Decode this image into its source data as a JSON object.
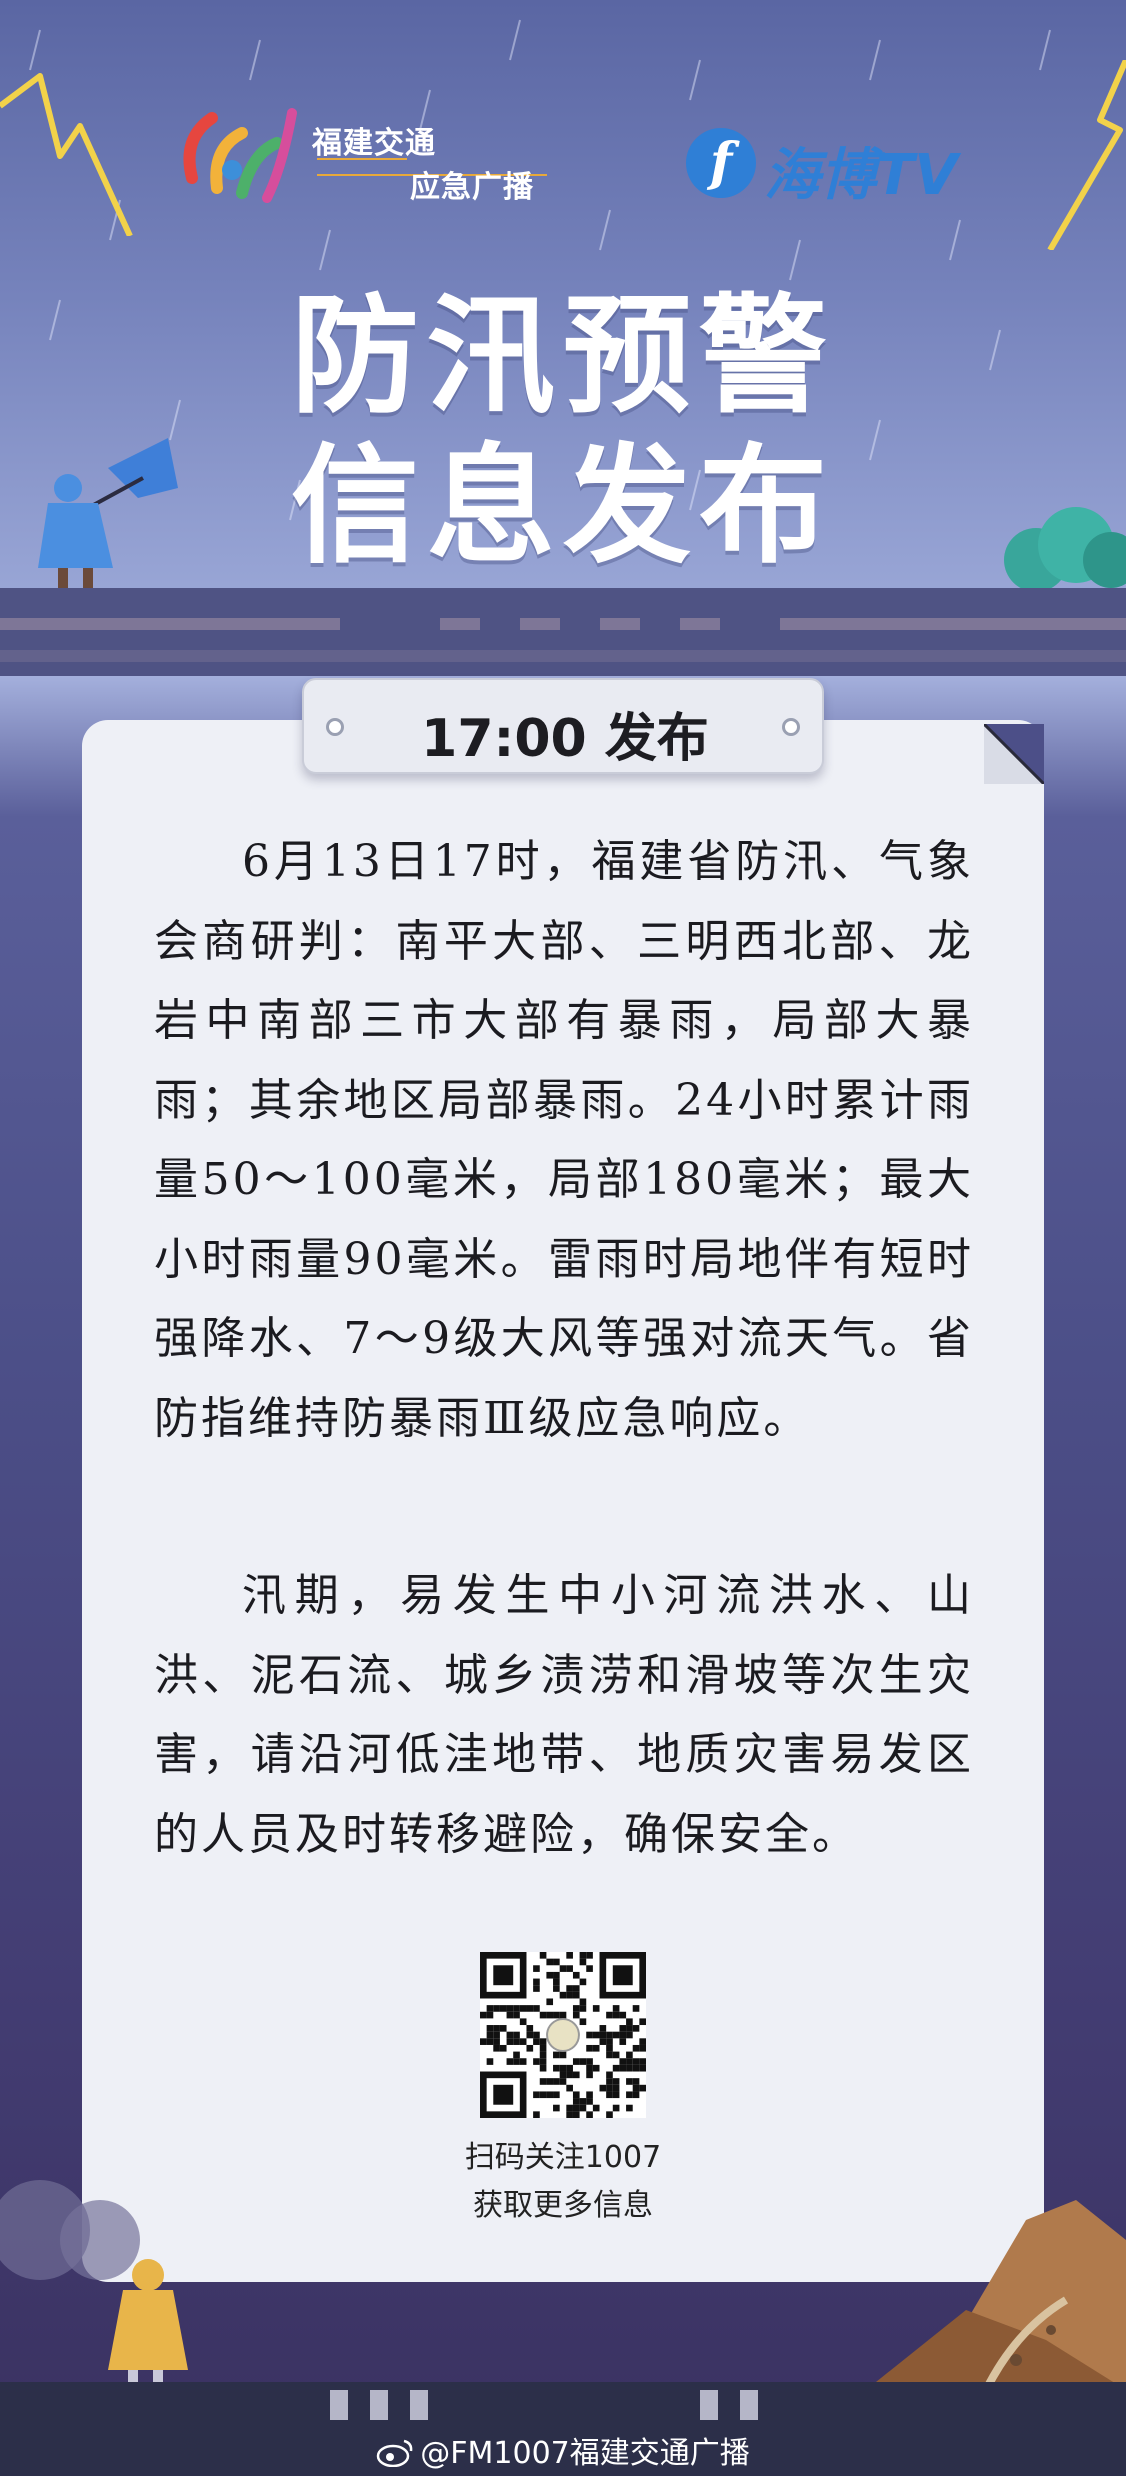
{
  "header": {
    "logo_left": {
      "line1": "福建交通",
      "line2": "应急广播"
    },
    "logo_right": {
      "icon_glyph": "f",
      "text": "海博TV"
    },
    "title_line1": "防汛预警",
    "title_line2": "信息发布"
  },
  "notice": {
    "tag_title": "17:00  发布",
    "paragraph1": "6月13日17时，福建省防汛、气象会商研判：南平大部、三明西北部、龙岩中南部三市大部有暴雨，局部大暴雨；其余地区局部暴雨。24小时累计雨量50～100毫米，局部180毫米；最大小时雨量90毫米。雷雨时局地伴有短时强降水、7～9级大风等强对流天气。省防指维持防暴雨Ⅲ级应急响应。",
    "paragraph2": "汛期，易发生中小河流洪水、山洪、泥石流、城乡渍涝和滑坡等次生灾害，请沿河低洼地带、地质灾害易发区的人员及时转移避险，确保安全。"
  },
  "qr": {
    "caption_line1": "扫码关注1007",
    "caption_line2": "获取更多信息"
  },
  "footer": {
    "watermark": "@FM1007福建交通广播"
  },
  "colors": {
    "sky_top": "#5a66a3",
    "card": "#eef0f6",
    "brand_blue": "#2f7fd6",
    "bolt_yellow": "#f2d24a"
  }
}
